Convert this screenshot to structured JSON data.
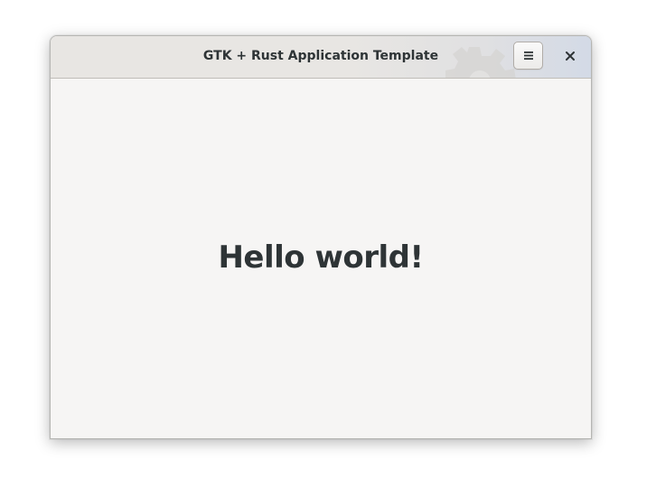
{
  "window": {
    "title": "GTK + Rust Application Template"
  },
  "headerbar": {
    "menu_icon": "hamburger-menu-icon",
    "close_icon": "close-icon",
    "decoration_icon": "gear-icon"
  },
  "main": {
    "label": "Hello world!"
  },
  "colors": {
    "text": "#2e3436",
    "background": "#f6f5f4",
    "headerbar": "#e8e6e3"
  }
}
